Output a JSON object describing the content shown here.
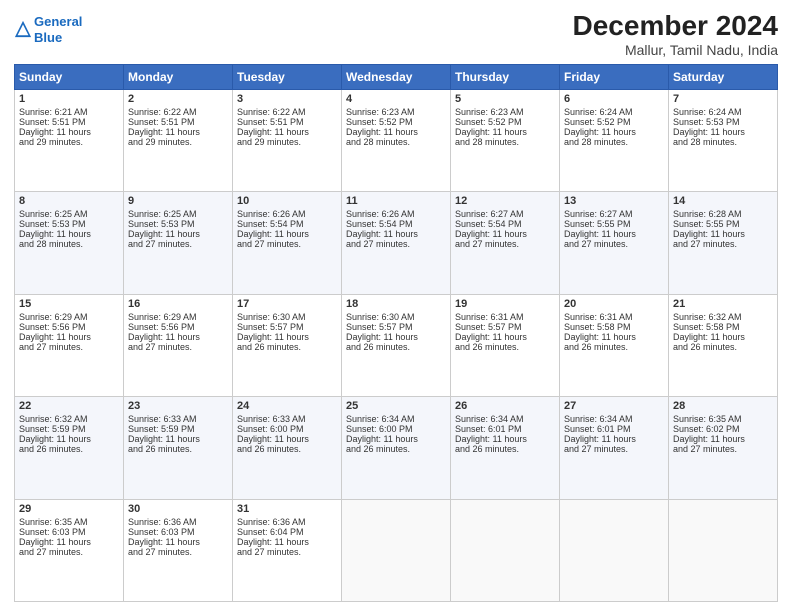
{
  "header": {
    "logo_line1": "General",
    "logo_line2": "Blue",
    "title": "December 2024",
    "subtitle": "Mallur, Tamil Nadu, India"
  },
  "days_of_week": [
    "Sunday",
    "Monday",
    "Tuesday",
    "Wednesday",
    "Thursday",
    "Friday",
    "Saturday"
  ],
  "weeks": [
    [
      {
        "day": "1",
        "info": "Sunrise: 6:21 AM\nSunset: 5:51 PM\nDaylight: 11 hours\nand 29 minutes."
      },
      {
        "day": "2",
        "info": "Sunrise: 6:22 AM\nSunset: 5:51 PM\nDaylight: 11 hours\nand 29 minutes."
      },
      {
        "day": "3",
        "info": "Sunrise: 6:22 AM\nSunset: 5:51 PM\nDaylight: 11 hours\nand 29 minutes."
      },
      {
        "day": "4",
        "info": "Sunrise: 6:23 AM\nSunset: 5:52 PM\nDaylight: 11 hours\nand 28 minutes."
      },
      {
        "day": "5",
        "info": "Sunrise: 6:23 AM\nSunset: 5:52 PM\nDaylight: 11 hours\nand 28 minutes."
      },
      {
        "day": "6",
        "info": "Sunrise: 6:24 AM\nSunset: 5:52 PM\nDaylight: 11 hours\nand 28 minutes."
      },
      {
        "day": "7",
        "info": "Sunrise: 6:24 AM\nSunset: 5:53 PM\nDaylight: 11 hours\nand 28 minutes."
      }
    ],
    [
      {
        "day": "8",
        "info": "Sunrise: 6:25 AM\nSunset: 5:53 PM\nDaylight: 11 hours\nand 28 minutes."
      },
      {
        "day": "9",
        "info": "Sunrise: 6:25 AM\nSunset: 5:53 PM\nDaylight: 11 hours\nand 27 minutes."
      },
      {
        "day": "10",
        "info": "Sunrise: 6:26 AM\nSunset: 5:54 PM\nDaylight: 11 hours\nand 27 minutes."
      },
      {
        "day": "11",
        "info": "Sunrise: 6:26 AM\nSunset: 5:54 PM\nDaylight: 11 hours\nand 27 minutes."
      },
      {
        "day": "12",
        "info": "Sunrise: 6:27 AM\nSunset: 5:54 PM\nDaylight: 11 hours\nand 27 minutes."
      },
      {
        "day": "13",
        "info": "Sunrise: 6:27 AM\nSunset: 5:55 PM\nDaylight: 11 hours\nand 27 minutes."
      },
      {
        "day": "14",
        "info": "Sunrise: 6:28 AM\nSunset: 5:55 PM\nDaylight: 11 hours\nand 27 minutes."
      }
    ],
    [
      {
        "day": "15",
        "info": "Sunrise: 6:29 AM\nSunset: 5:56 PM\nDaylight: 11 hours\nand 27 minutes."
      },
      {
        "day": "16",
        "info": "Sunrise: 6:29 AM\nSunset: 5:56 PM\nDaylight: 11 hours\nand 27 minutes."
      },
      {
        "day": "17",
        "info": "Sunrise: 6:30 AM\nSunset: 5:57 PM\nDaylight: 11 hours\nand 26 minutes."
      },
      {
        "day": "18",
        "info": "Sunrise: 6:30 AM\nSunset: 5:57 PM\nDaylight: 11 hours\nand 26 minutes."
      },
      {
        "day": "19",
        "info": "Sunrise: 6:31 AM\nSunset: 5:57 PM\nDaylight: 11 hours\nand 26 minutes."
      },
      {
        "day": "20",
        "info": "Sunrise: 6:31 AM\nSunset: 5:58 PM\nDaylight: 11 hours\nand 26 minutes."
      },
      {
        "day": "21",
        "info": "Sunrise: 6:32 AM\nSunset: 5:58 PM\nDaylight: 11 hours\nand 26 minutes."
      }
    ],
    [
      {
        "day": "22",
        "info": "Sunrise: 6:32 AM\nSunset: 5:59 PM\nDaylight: 11 hours\nand 26 minutes."
      },
      {
        "day": "23",
        "info": "Sunrise: 6:33 AM\nSunset: 5:59 PM\nDaylight: 11 hours\nand 26 minutes."
      },
      {
        "day": "24",
        "info": "Sunrise: 6:33 AM\nSunset: 6:00 PM\nDaylight: 11 hours\nand 26 minutes."
      },
      {
        "day": "25",
        "info": "Sunrise: 6:34 AM\nSunset: 6:00 PM\nDaylight: 11 hours\nand 26 minutes."
      },
      {
        "day": "26",
        "info": "Sunrise: 6:34 AM\nSunset: 6:01 PM\nDaylight: 11 hours\nand 26 minutes."
      },
      {
        "day": "27",
        "info": "Sunrise: 6:34 AM\nSunset: 6:01 PM\nDaylight: 11 hours\nand 27 minutes."
      },
      {
        "day": "28",
        "info": "Sunrise: 6:35 AM\nSunset: 6:02 PM\nDaylight: 11 hours\nand 27 minutes."
      }
    ],
    [
      {
        "day": "29",
        "info": "Sunrise: 6:35 AM\nSunset: 6:03 PM\nDaylight: 11 hours\nand 27 minutes."
      },
      {
        "day": "30",
        "info": "Sunrise: 6:36 AM\nSunset: 6:03 PM\nDaylight: 11 hours\nand 27 minutes."
      },
      {
        "day": "31",
        "info": "Sunrise: 6:36 AM\nSunset: 6:04 PM\nDaylight: 11 hours\nand 27 minutes."
      },
      null,
      null,
      null,
      null
    ]
  ]
}
